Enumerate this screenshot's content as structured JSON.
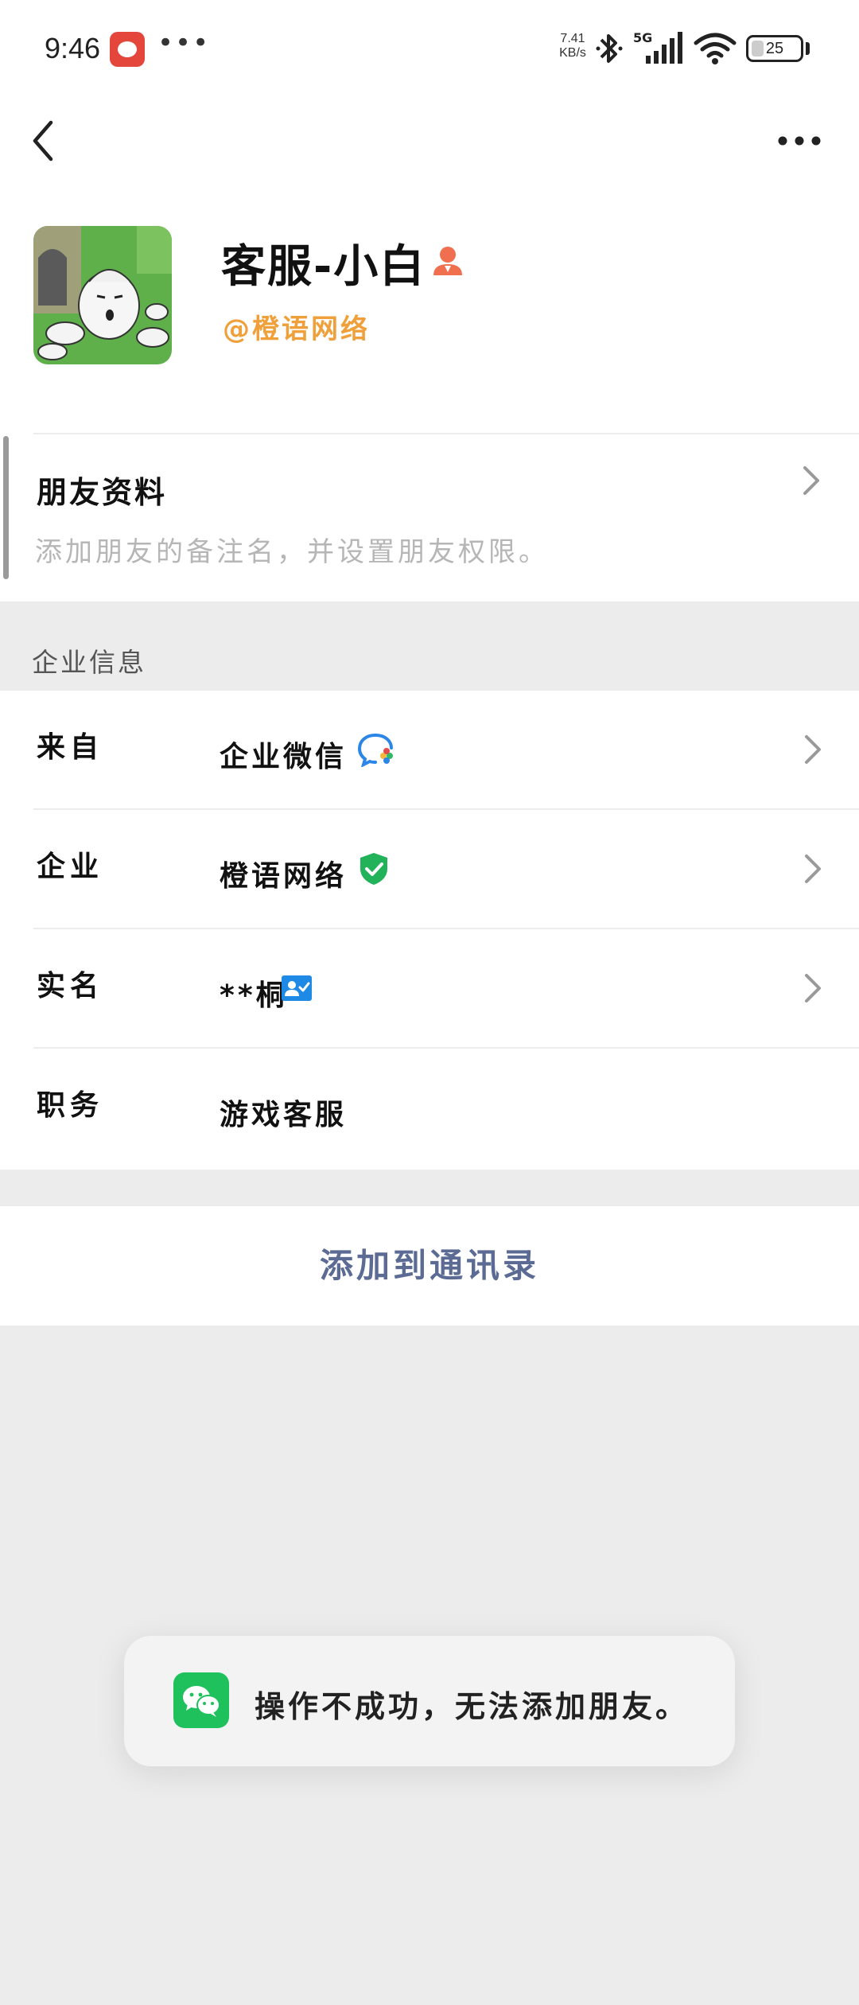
{
  "status_bar": {
    "time": "9:46",
    "more_dots": "•••",
    "net_speed_value": "7.41",
    "net_speed_unit": "KB/s",
    "network_type": "5G",
    "battery_percent": "25",
    "battery_level": 0.25
  },
  "header": {
    "name": "客服-小白",
    "corp_tag": "@橙语网络"
  },
  "friend_info": {
    "title": "朋友资料",
    "subtitle": "添加朋友的备注名，并设置朋友权限。"
  },
  "section": {
    "enterprise_label": "企业信息"
  },
  "info_rows": [
    {
      "label": "来自",
      "value": "企业微信",
      "icon": "wecom-icon",
      "has_arrow": true
    },
    {
      "label": "企业",
      "value": "橙语网络",
      "icon": "verified-shield-icon",
      "has_arrow": true
    },
    {
      "label": "实名",
      "value": "**桐",
      "icon": "realname-card-icon",
      "has_arrow": true
    },
    {
      "label": "职务",
      "value": "游戏客服",
      "icon": "",
      "has_arrow": false
    }
  ],
  "add_button": {
    "label": "添加到通讯录"
  },
  "toast": {
    "message": "操作不成功，无法添加朋友。"
  },
  "colors": {
    "corp_orange": "#f0a03a",
    "add_button_text": "#5b6b93",
    "wechat_green": "#1fc15d",
    "verified_green": "#22b35a",
    "realname_blue": "#1e8ae6",
    "background": "#ececec"
  }
}
